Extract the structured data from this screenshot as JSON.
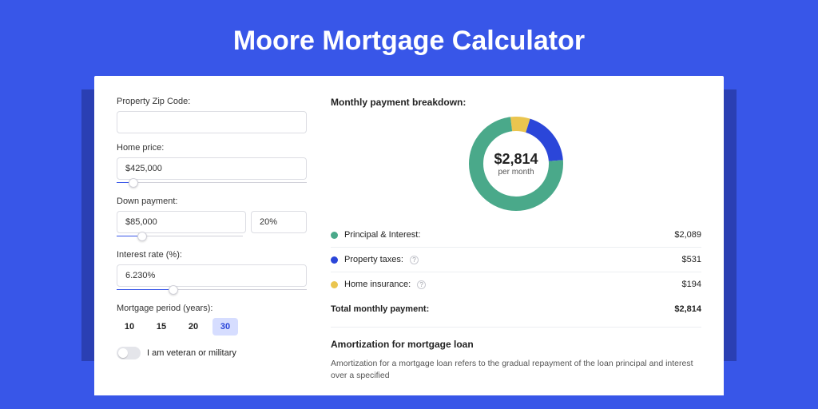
{
  "title": "Moore Mortgage Calculator",
  "form": {
    "zip_label": "Property Zip Code:",
    "zip_value": "",
    "home_label": "Home price:",
    "home_value": "$425,000",
    "home_slider_pct": 9,
    "down_label": "Down payment:",
    "down_value": "$85,000",
    "down_pct": "20%",
    "down_slider_pct": 20,
    "rate_label": "Interest rate (%):",
    "rate_value": "6.230%",
    "rate_slider_pct": 30,
    "period_label": "Mortgage period (years):",
    "periods": [
      "10",
      "15",
      "20",
      "30"
    ],
    "period_active_index": 3,
    "veteran_label": "I am veteran or military"
  },
  "breakdown": {
    "title": "Monthly payment breakdown:",
    "center_amount": "$2,814",
    "center_sub": "per month",
    "items": [
      {
        "label": "Principal & Interest:",
        "value": "$2,089",
        "color": "#4aa98a",
        "info": false
      },
      {
        "label": "Property taxes:",
        "value": "$531",
        "color": "#2b46d9",
        "info": true
      },
      {
        "label": "Home insurance:",
        "value": "$194",
        "color": "#eac54f",
        "info": true
      }
    ],
    "total_label": "Total monthly payment:",
    "total_value": "$2,814"
  },
  "amort": {
    "title": "Amortization for mortgage loan",
    "body": "Amortization for a mortgage loan refers to the gradual repayment of the loan principal and interest over a specified"
  },
  "chart_data": {
    "type": "pie",
    "title": "Monthly payment breakdown",
    "series": [
      {
        "name": "Principal & Interest",
        "value": 2089,
        "color": "#4aa98a"
      },
      {
        "name": "Property taxes",
        "value": 531,
        "color": "#2b46d9"
      },
      {
        "name": "Home insurance",
        "value": 194,
        "color": "#eac54f"
      }
    ],
    "total": 2814,
    "center_label": "$2,814 per month"
  }
}
